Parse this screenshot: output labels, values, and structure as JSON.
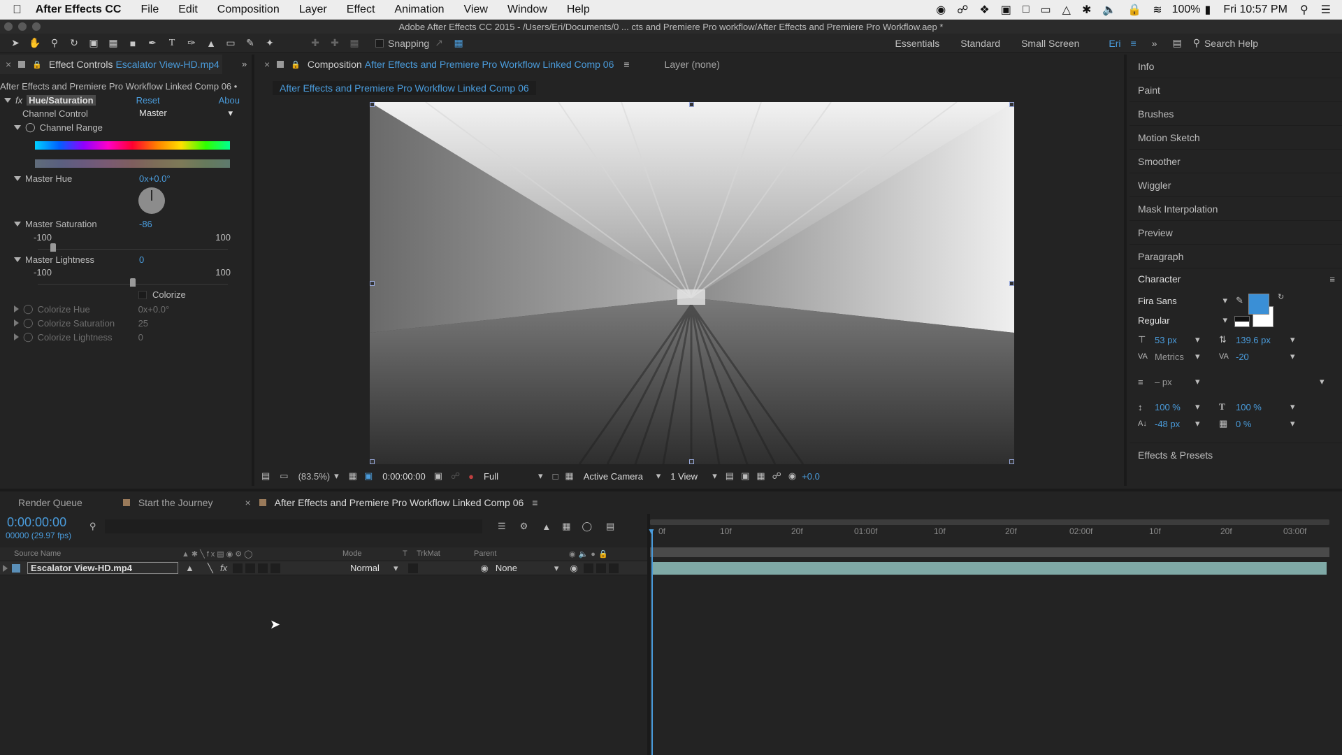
{
  "menubar": {
    "app": "After Effects CC",
    "items": [
      "File",
      "Edit",
      "Composition",
      "Layer",
      "Effect",
      "Animation",
      "View",
      "Window",
      "Help"
    ],
    "battery": "100%",
    "clock": "Fri 10:57 PM"
  },
  "window_title": "Adobe After Effects CC 2015 - /Users/Eri/Documents/0 ... cts and Premiere Pro workflow/After Effects and Premiere Pro Workflow.aep *",
  "toolbar": {
    "snapping": "Snapping",
    "workspaces": [
      "Essentials",
      "Standard",
      "Small Screen",
      "Eri"
    ],
    "search": "Search Help"
  },
  "effect_controls": {
    "tab_prefix": "Effect Controls",
    "tab_file": "Escalator View-HD.mp4",
    "comp_line": "After Effects and Premiere Pro Workflow Linked Comp 06 •",
    "effect_name": "Hue/Saturation",
    "reset": "Reset",
    "about": "Abou",
    "channel_control_label": "Channel Control",
    "channel_control_value": "Master",
    "channel_range_label": "Channel Range",
    "master_hue_label": "Master Hue",
    "master_hue_value": "0x+0.0°",
    "master_sat_label": "Master Saturation",
    "master_sat_value": "-86",
    "master_sat_min": "-100",
    "master_sat_max": "100",
    "master_sat_level": 0.07,
    "master_light_label": "Master Lightness",
    "master_light_value": "0",
    "master_light_min": "-100",
    "master_light_max": "100",
    "master_light_level": 0.5,
    "colorize_label": "Colorize",
    "colorize_hue_label": "Colorize Hue",
    "colorize_hue_value": "0x+0.0°",
    "colorize_sat_label": "Colorize Saturation",
    "colorize_sat_value": "25",
    "colorize_light_label": "Colorize Lightness",
    "colorize_light_value": "0"
  },
  "composition": {
    "tab_prefix": "Composition",
    "tab_name": "After Effects and Premiere Pro Workflow Linked Comp 06",
    "layer_tab": "Layer (none)",
    "breadcrumb": "After Effects and Premiere Pro Workflow Linked Comp 06",
    "zoom": "(83.5%)",
    "timecode": "0:00:00:00",
    "resolution": "Full",
    "camera": "Active Camera",
    "views": "1 View",
    "exposure": "+0.0"
  },
  "right_panels": [
    "Info",
    "Paint",
    "Brushes",
    "Motion Sketch",
    "Smoother",
    "Wiggler",
    "Mask Interpolation",
    "Preview",
    "Paragraph"
  ],
  "character": {
    "title": "Character",
    "font": "Fira Sans",
    "style": "Regular",
    "size": "53 px",
    "leading": "139.6 px",
    "kerning": "Metrics",
    "tracking": "-20",
    "stroke": "– px",
    "vscale": "100 %",
    "hscale": "100 %",
    "baseline": "-48 px",
    "tsume": "0 %",
    "fill_color": "#3a8fd6"
  },
  "effects_presets": "Effects & Presets",
  "timeline": {
    "tabs": [
      "Render Queue",
      "Start the Journey",
      "After Effects and Premiere Pro Workflow Linked Comp 06"
    ],
    "timecode": "0:00:00:00",
    "frames": "00000 (29.97 fps)",
    "col_source": "Source Name",
    "col_mode": "Mode",
    "col_t": "T",
    "col_trkmat": "TrkMat",
    "col_parent": "Parent",
    "layer_name": "Escalator View-HD.mp4",
    "layer_mode": "Normal",
    "layer_parent": "None",
    "ruler": [
      "0f",
      "10f",
      "20f",
      "01:00f",
      "10f",
      "20f",
      "02:00f",
      "10f",
      "20f",
      "03:00f"
    ]
  }
}
